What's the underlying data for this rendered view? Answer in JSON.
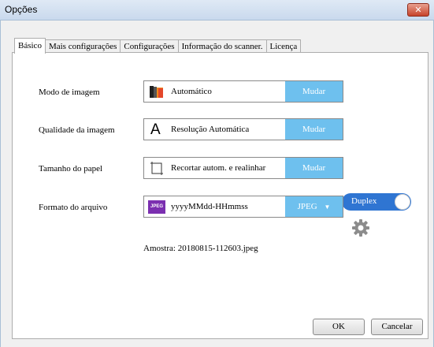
{
  "window": {
    "title": "Opções",
    "close_glyph": "✕"
  },
  "tabs": [
    {
      "label": "Básico",
      "active": true
    },
    {
      "label": "Mais configurações",
      "active": false
    },
    {
      "label": "Configurações",
      "active": false
    },
    {
      "label": "Informação do scanner.",
      "active": false
    },
    {
      "label": "Licença",
      "active": false
    }
  ],
  "settings": {
    "image_mode": {
      "label": "Modo de imagem",
      "value": "Automático",
      "button": "Mudar",
      "icon": "color-mode-icon"
    },
    "image_quality": {
      "label": "Qualidade da imagem",
      "value": "Resolução Automática",
      "button": "Mudar",
      "icon": "letter-a-icon",
      "icon_glyph": "A"
    },
    "paper_size": {
      "label": "Tamanho do papel",
      "value": "Recortar autom. e realinhar",
      "button": "Mudar",
      "icon": "crop-page-icon"
    },
    "file_format": {
      "label": "Formato do arquivo",
      "value": "yyyyMMdd-HHmmss",
      "format": "JPEG",
      "icon": "jpeg-icon",
      "icon_text": "JPEG",
      "dropdown_glyph": "▼"
    },
    "sample": "Amostra: 20180815-112603.jpeg"
  },
  "duplex": {
    "label": "Duplex",
    "on": true
  },
  "footer": {
    "ok": "OK",
    "cancel": "Cancelar"
  },
  "colors": {
    "accent": "#6ec0ee",
    "toggle": "#2f75d2",
    "jpeg": "#7b2fb0"
  }
}
